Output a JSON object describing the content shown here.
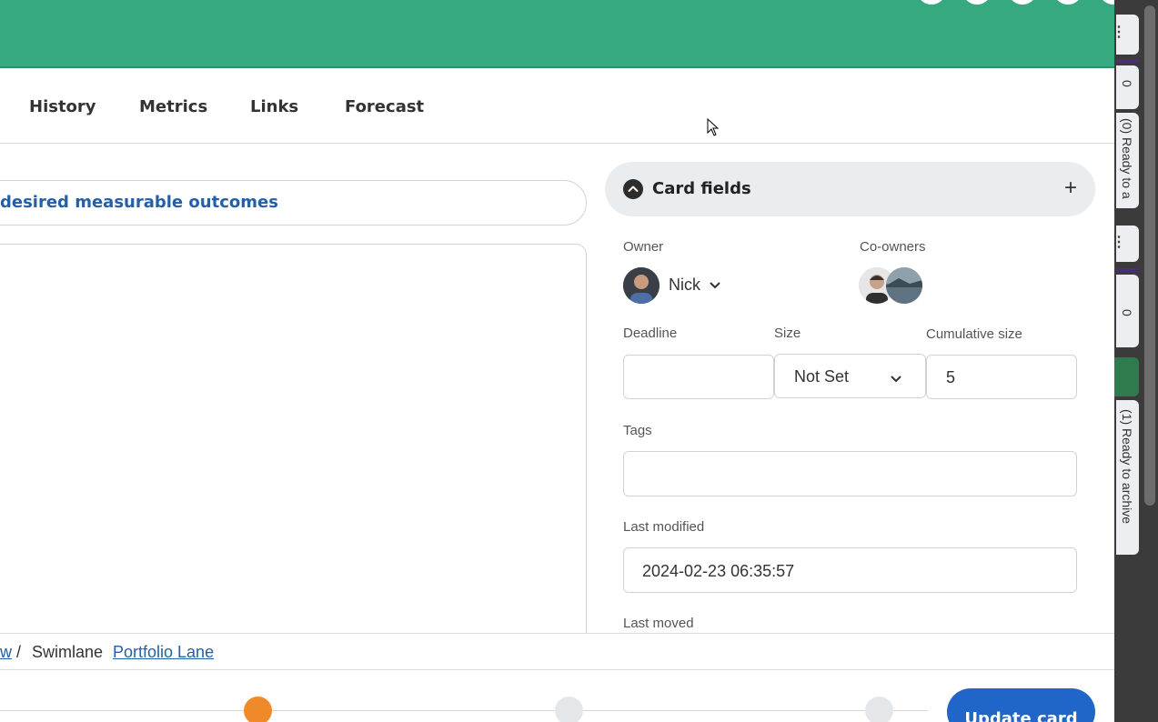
{
  "tabs": [
    "History",
    "Metrics",
    "Links",
    "Forecast"
  ],
  "outcome_field": "desired measurable outcomes",
  "card_fields": {
    "title": "Card fields",
    "owner_label": "Owner",
    "owner_name": "Nick",
    "coowners_label": "Co-owners",
    "deadline_label": "Deadline",
    "deadline_value": "",
    "size_label": "Size",
    "size_value": "Not Set",
    "cumulative_label": "Cumulative size",
    "cumulative_value": "5",
    "tags_label": "Tags",
    "tags_value": "",
    "last_modified_label": "Last modified",
    "last_modified_value": "2024-02-23 06:35:57",
    "last_moved_label": "Last moved"
  },
  "breadcrumb": {
    "prev_fragment": "w",
    "separator": "/",
    "swimlane_label": "Swimlane",
    "swimlane_link": "Portfolio Lane"
  },
  "side_strip": {
    "count_1": "0",
    "lane_1": "(0) Ready to a",
    "count_2": "0",
    "lane_2": "(1) Ready to archive"
  },
  "update_button": "Update card",
  "colors": {
    "header_green": "#37a97e",
    "link_blue": "#2460a7",
    "button_blue": "#1f66c8",
    "active_step": "#f0892a"
  }
}
